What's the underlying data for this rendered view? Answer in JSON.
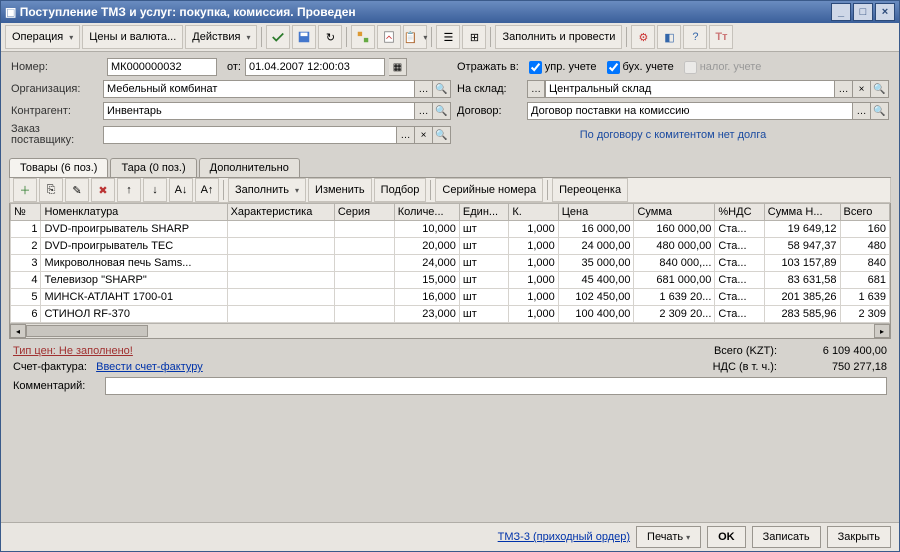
{
  "title": "Поступление ТМЗ и услуг: покупка, комиссия. Проведен",
  "toolbar": {
    "operation": "Операция",
    "prices": "Цены и валюта...",
    "actions": "Действия",
    "fill_and_post": "Заполнить и провести"
  },
  "form": {
    "number_lbl": "Номер:",
    "number": "МК000000032",
    "from_lbl": "от:",
    "date": "01.04.2007 12:00:03",
    "org_lbl": "Организация:",
    "org": "Мебельный комбинат",
    "contr_lbl": "Контрагент:",
    "contr": "Инвентарь",
    "order_lbl": "Заказ поставщику:",
    "order": "",
    "reflect_lbl": "Отражать в:",
    "chk_upr": "упр. учете",
    "chk_bux": "бух. учете",
    "chk_nal": "налог. учете",
    "warehouse_lbl": "На склад:",
    "warehouse": "Центральный склад",
    "contract_lbl": "Договор:",
    "contract": "Договор поставки на комиссию",
    "agreement_note": "По договору с комитентом нет долга"
  },
  "tabs": {
    "goods": "Товары (6 поз.)",
    "tara": "Тара (0 поз.)",
    "extra": "Дополнительно"
  },
  "subtoolbar": {
    "fill": "Заполнить",
    "change": "Изменить",
    "select": "Подбор",
    "serial": "Серийные номера",
    "reval": "Переоценка"
  },
  "grid": {
    "headers": {
      "n": "№",
      "nomen": "Номенклатура",
      "char": "Характеристика",
      "series": "Серия",
      "qty": "Количе...",
      "unit": "Един...",
      "k": "К.",
      "price": "Цена",
      "sum": "Сумма",
      "vatp": "%НДС",
      "vat": "Сумма Н...",
      "total": "Всего"
    },
    "rows": [
      {
        "n": "1",
        "nomen": "DVD-проигрыватель SHARP",
        "char": "",
        "series": "",
        "qty": "10,000",
        "unit": "шт",
        "k": "1,000",
        "price": "16 000,00",
        "sum": "160 000,00",
        "vatp": "Ста...",
        "vat": "19 649,12",
        "total": "160"
      },
      {
        "n": "2",
        "nomen": "DVD-проигрыватель TEC",
        "char": "",
        "series": "",
        "qty": "20,000",
        "unit": "шт",
        "k": "1,000",
        "price": "24 000,00",
        "sum": "480 000,00",
        "vatp": "Ста...",
        "vat": "58 947,37",
        "total": "480"
      },
      {
        "n": "3",
        "nomen": "Микроволновая печь Sams...",
        "char": "",
        "series": "",
        "qty": "24,000",
        "unit": "шт",
        "k": "1,000",
        "price": "35 000,00",
        "sum": "840 000,...",
        "vatp": "Ста...",
        "vat": "103 157,89",
        "total": "840"
      },
      {
        "n": "4",
        "nomen": "Телевизор \"SHARP\"",
        "char": "",
        "series": "",
        "qty": "15,000",
        "unit": "шт",
        "k": "1,000",
        "price": "45 400,00",
        "sum": "681 000,00",
        "vatp": "Ста...",
        "vat": "83 631,58",
        "total": "681"
      },
      {
        "n": "5",
        "nomen": "МИНСК-АТЛАНТ 1700-01",
        "char": "",
        "series": "",
        "qty": "16,000",
        "unit": "шт",
        "k": "1,000",
        "price": "102 450,00",
        "sum": "1 639 20...",
        "vatp": "Ста...",
        "vat": "201 385,26",
        "total": "1 639"
      },
      {
        "n": "6",
        "nomen": "СТИНОЛ RF-370",
        "char": "",
        "series": "",
        "qty": "23,000",
        "unit": "шт",
        "k": "1,000",
        "price": "100 400,00",
        "sum": "2 309 20...",
        "vatp": "Ста...",
        "vat": "283 585,96",
        "total": "2 309"
      }
    ]
  },
  "footer": {
    "price_type_lbl": "Тип цен: Не заполнено!",
    "total_lbl": "Всего (KZT):",
    "total": "6 109 400,00",
    "invoice_lbl": "Счет-фактура:",
    "invoice_link": "Ввести счет-фактуру",
    "vat_lbl": "НДС (в т. ч.):",
    "vat": "750 277,18",
    "comment_lbl": "Комментарий:",
    "comment": ""
  },
  "bottom": {
    "doc": "ТМЗ-3 (приходный ордер)",
    "print": "Печать",
    "ok": "OK",
    "save": "Записать",
    "close": "Закрыть"
  }
}
